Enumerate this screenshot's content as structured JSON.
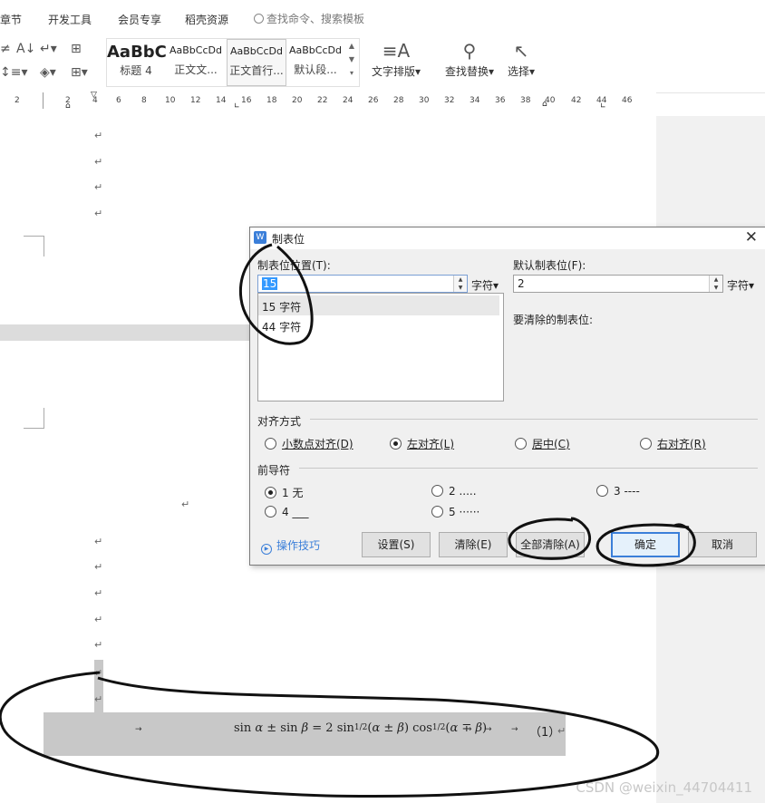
{
  "menu": {
    "items": [
      "章节",
      "开发工具",
      "会员专享",
      "稻壳资源"
    ],
    "search_placeholder": "查找命令、搜索模板"
  },
  "ribbon": {
    "styles": [
      {
        "sample": "AaBbC",
        "name": "标题 4"
      },
      {
        "sample": "AaBbCcDd",
        "name": "正文文..."
      },
      {
        "sample": "AaBbCcDd",
        "name": "正文首行..."
      },
      {
        "sample": "AaBbCcDd",
        "name": "默认段..."
      }
    ],
    "text_layout": "文字排版",
    "find_replace": "查找替换",
    "select": "选择"
  },
  "ruler": {
    "ticks": [
      "2",
      "2",
      "4",
      "6",
      "8",
      "10",
      "12",
      "14",
      "16",
      "18",
      "20",
      "22",
      "24",
      "26",
      "28",
      "30",
      "32",
      "34",
      "36",
      "38",
      "40",
      "42",
      "44",
      "46"
    ]
  },
  "document": {
    "paragraph_mark": "↵",
    "tab_arrow": "→",
    "formula": "sin α ± sin β = 2 sin ½(α ± β) cos ½(α ∓ β)",
    "equation_number": "（1）"
  },
  "dialog": {
    "title": "制表位",
    "tab_position_label": "制表位位置(T):",
    "tab_position_value": "15",
    "unit": "字符",
    "tab_list": [
      "15 字符",
      "44 字符"
    ],
    "default_tab_label": "默认制表位(F):",
    "default_tab_value": "2",
    "clear_label": "要清除的制表位:",
    "alignment_label": "对齐方式",
    "alignment_options": [
      {
        "label": "小数点对齐(D)",
        "selected": false
      },
      {
        "label": "左对齐(L)",
        "selected": true
      },
      {
        "label": "居中(C)",
        "selected": false
      },
      {
        "label": "右对齐(R)",
        "selected": false
      }
    ],
    "leader_label": "前导符",
    "leader_options": [
      {
        "label": "1 无",
        "selected": true
      },
      {
        "label": "2 .....",
        "selected": false
      },
      {
        "label": "3 ----",
        "selected": false
      },
      {
        "label": "4 ___",
        "selected": false
      },
      {
        "label": "5 ······",
        "selected": false
      }
    ],
    "tips": "操作技巧",
    "buttons": {
      "set": "设置(S)",
      "clear": "清除(E)",
      "clear_all": "全部清除(A)",
      "ok": "确定",
      "cancel": "取消"
    }
  },
  "watermark": "CSDN @weixin_44704411"
}
